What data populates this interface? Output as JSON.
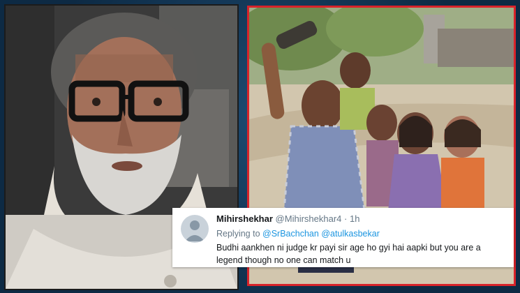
{
  "tweet": {
    "display_name": "Mihirshekhar",
    "handle": "@Mihirshekhar4",
    "separator": "·",
    "time": "1h",
    "replying_to_label": "Replying to",
    "mentions": [
      "@SrBachchan",
      "@atulkasbekar"
    ],
    "text": "Budhi aankhen ni judge kr payi sir age ho gyi hai aapki but you are a legend though no one can match u"
  },
  "colors": {
    "background": "#0d2a44",
    "right_frame": "#d8232a",
    "mention": "#1b95e0",
    "name": "#14171a",
    "secondary": "#657786"
  },
  "icons": [
    "default-avatar-icon"
  ]
}
